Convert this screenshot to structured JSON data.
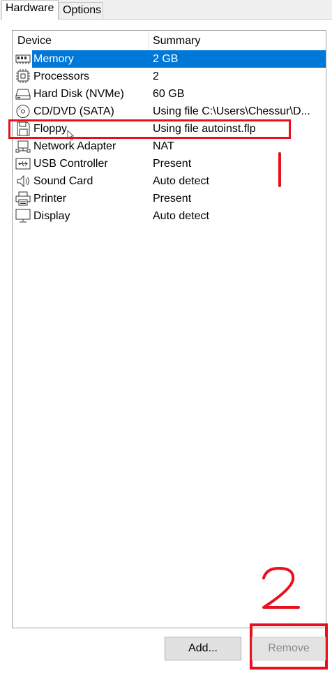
{
  "tabs": [
    {
      "label": "Hardware",
      "active": true
    },
    {
      "label": "Options",
      "active": false
    }
  ],
  "table": {
    "columns": [
      "Device",
      "Summary"
    ],
    "rows": [
      {
        "device": "Memory",
        "summary": "2 GB",
        "icon": "memory-icon",
        "selected": true
      },
      {
        "device": "Processors",
        "summary": "2",
        "icon": "processor-icon"
      },
      {
        "device": "Hard Disk (NVMe)",
        "summary": "60 GB",
        "icon": "hard-disk-icon"
      },
      {
        "device": "CD/DVD (SATA)",
        "summary": "Using file C:\\Users\\Chessur\\D...",
        "icon": "cd-dvd-icon"
      },
      {
        "device": "Floppy",
        "summary": "Using file autoinst.flp",
        "icon": "floppy-icon"
      },
      {
        "device": "Network Adapter",
        "summary": "NAT",
        "icon": "network-adapter-icon"
      },
      {
        "device": "USB Controller",
        "summary": "Present",
        "icon": "usb-icon"
      },
      {
        "device": "Sound Card",
        "summary": "Auto detect",
        "icon": "speaker-icon"
      },
      {
        "device": "Printer",
        "summary": "Present",
        "icon": "printer-icon"
      },
      {
        "device": "Display",
        "summary": "Auto detect",
        "icon": "monitor-icon"
      }
    ]
  },
  "buttons": {
    "add": "Add...",
    "remove": "Remove"
  },
  "colors": {
    "selection": "#0078d7",
    "annotation": "#e8101c"
  }
}
